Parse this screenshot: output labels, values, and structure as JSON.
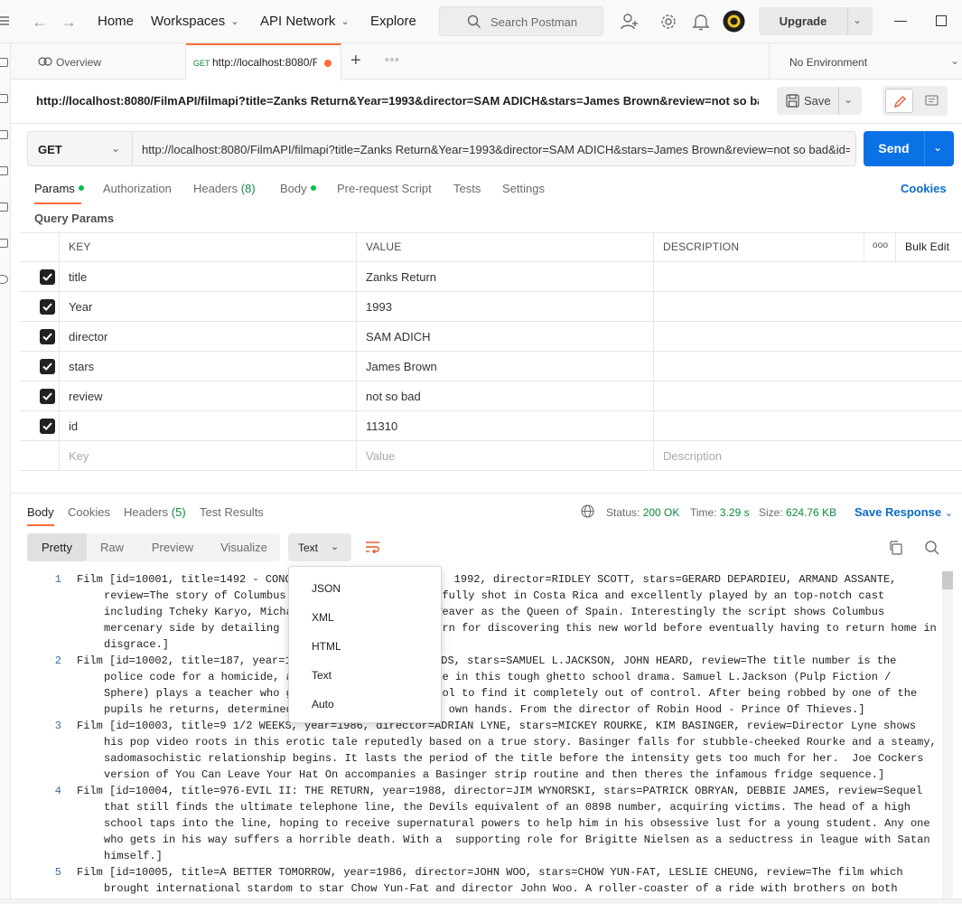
{
  "topbar": {
    "nav": [
      "Home",
      "Workspaces",
      "API Network",
      "Explore"
    ],
    "search_placeholder": "Search Postman",
    "upgrade_label": "Upgrade"
  },
  "tabs": {
    "overview_label": "Overview",
    "active_method": "GET",
    "active_url": "http://localhost:8080/F",
    "environment": "No Environment"
  },
  "request": {
    "title": "http://localhost:8080/FilmAPI/filmapi?title=Zanks Return&Year=1993&director=SAM ADICH&stars=James Brown&review=not so bad...",
    "save_label": "Save",
    "method": "GET",
    "url": "http://localhost:8080/FilmAPI/filmapi?title=Zanks Return&Year=1993&director=SAM ADICH&stars=James Brown&review=not so bad&id=11310",
    "send_label": "Send",
    "tabs": [
      {
        "label": "Params"
      },
      {
        "label": "Authorization"
      },
      {
        "label": "Headers",
        "count": "(8)"
      },
      {
        "label": "Body"
      },
      {
        "label": "Pre-request Script"
      },
      {
        "label": "Tests"
      },
      {
        "label": "Settings"
      }
    ],
    "cookies_label": "Cookies",
    "query_params_title": "Query Params"
  },
  "params": {
    "columns": [
      "KEY",
      "VALUE",
      "DESCRIPTION"
    ],
    "more_label": "ooo",
    "bulk_edit_label": "Bulk Edit",
    "rows": [
      {
        "key": "title",
        "value": "Zanks Return"
      },
      {
        "key": "Year",
        "value": "1993"
      },
      {
        "key": "director",
        "value": "SAM ADICH"
      },
      {
        "key": "stars",
        "value": "James Brown"
      },
      {
        "key": "review",
        "value": "not so bad"
      },
      {
        "key": "id",
        "value": "11310"
      }
    ],
    "placeholders": {
      "key": "Key",
      "value": "Value",
      "description": "Description"
    }
  },
  "response": {
    "tabs": [
      {
        "label": "Body"
      },
      {
        "label": "Cookies"
      },
      {
        "label": "Headers",
        "count": "(5)"
      },
      {
        "label": "Test Results"
      }
    ],
    "status_label": "Status:",
    "status_value": "200 OK",
    "time_label": "Time:",
    "time_value": "3.29 s",
    "size_label": "Size:",
    "size_value": "624.76 KB",
    "save_response_label": "Save Response",
    "views": [
      "Pretty",
      "Raw",
      "Preview",
      "Visualize"
    ],
    "format_selected": "Text",
    "format_options": [
      "JSON",
      "XML",
      "HTML",
      "Text",
      "Auto"
    ],
    "lines": [
      {
        "n": "1",
        "text": "Film [id=10001, title=1492 - CONQ                         1992, director=RIDLEY SCOTT, stars=GERARD DEPARDIEU, ARMAND ASSANTE, review=The story of Columbus                    autifully shot in Costa Rica and excellently played by an top-notch cast including Tcheky Karyo, Micha                    y Weaver as the Queen of Spain. Interestingly the script shows Columbus mercenary side by detailing                      eturn for discovering this new world before eventually having to return home in disgrace.]"
      },
      {
        "n": "2",
        "text": "Film [id=10002, title=187, year=1                    NOLDS, stars=SAMUEL L.JACKSON, JOHN HEARD, review=The title number is the police code for a homicide, a                    once in this tough ghetto school drama. Samuel L.Jackson (Pulp Fiction / Sphere) plays a teacher who g                     hool to find it completely out of control. After being robbed by one of the pupils he returns, determined                     is own hands. From the director of Robin Hood - Prince Of Thieves.]"
      },
      {
        "n": "3",
        "text": "Film [id=10003, title=9 1/2 WEEKS, year=1986, director=ADRIAN LYNE, stars=MICKEY ROURKE, KIM BASINGER, review=Director Lyne shows his pop video roots in this erotic tale reputedly based on a true story. Basinger falls for stubble-cheeked Rourke and a steamy, sadomasochistic relationship begins. It lasts the period of the title before the intensity gets too much for her.  Joe Cockers version of You Can Leave Your Hat On accompanies a Basinger strip routine and then theres the infamous fridge sequence.]"
      },
      {
        "n": "4",
        "text": "Film [id=10004, title=976-EVIL II: THE RETURN, year=1988, director=JIM WYNORSKI, stars=PATRICK OBRYAN, DEBBIE JAMES, review=Sequel that still finds the ultimate telephone line, the Devils equivalent of an 0898 number, acquiring victims. The head of a high school taps into the line, hoping to receive supernatural powers to help him in his obsessive lust for a young student. Any one who gets in his way suffers a horrible death. With a  supporting role for Brigitte Nielsen as a seductress in league with Satan himself.]"
      },
      {
        "n": "5",
        "text": "Film [id=10005, title=A BETTER TOMORROW, year=1986, director=JOHN WOO, stars=CHOW YUN-FAT, LESLIE CHEUNG, review=The film which brought international stardom to star Chow Yun-Fat and director John Woo. A roller-coaster of a ride with brothers on both"
      }
    ]
  },
  "colors": {
    "accent": "#ff6c37",
    "send_blue": "#0b72e5",
    "link_blue": "#0b6bcb",
    "success_green": "#0a8c3e"
  }
}
